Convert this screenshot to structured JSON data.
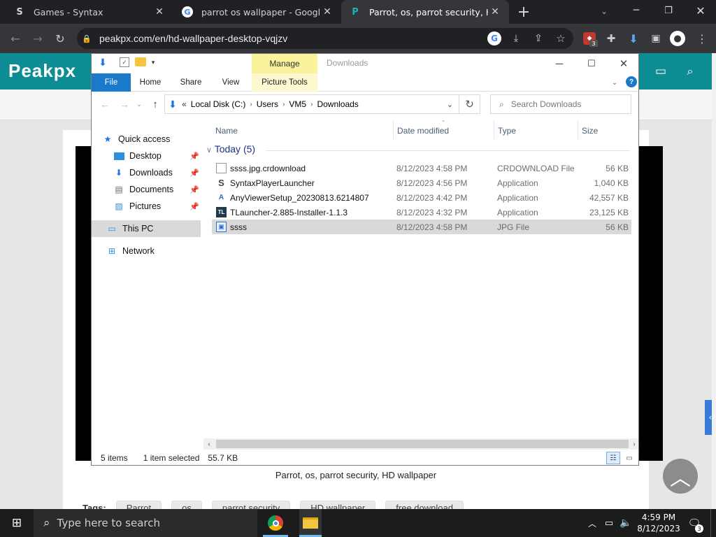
{
  "browser": {
    "tabs": [
      {
        "title": "Games - Syntax",
        "favicon": "S"
      },
      {
        "title": "parrot os wallpaper - Google Sea",
        "favicon": "G"
      },
      {
        "title": "Parrot, os, parrot security, HD wa",
        "favicon": "P"
      }
    ],
    "new_tab": "+",
    "url": "peakpx.com/en/hd-wallpaper-desktop-vqjzv",
    "ext_badge": "3"
  },
  "page": {
    "logo": "Peakpx",
    "caption": "Parrot, os, parrot security, HD wallpaper",
    "tags_label": "Tags:",
    "tags": [
      "Parrot",
      "os",
      "parrot security",
      "HD wallpaper",
      "free download"
    ]
  },
  "explorer": {
    "contextual_tab": "Manage",
    "window_title": "Downloads",
    "ribbon_tabs": [
      "File",
      "Home",
      "Share",
      "View",
      "Picture Tools"
    ],
    "address": {
      "prefix": "«",
      "crumbs": [
        "Local Disk (C:)",
        "Users",
        "VM5",
        "Downloads"
      ]
    },
    "search_placeholder": "Search Downloads",
    "nav_items": [
      {
        "label": "Quick access"
      },
      {
        "label": "Desktop"
      },
      {
        "label": "Downloads"
      },
      {
        "label": "Documents"
      },
      {
        "label": "Pictures"
      },
      {
        "label": "This PC"
      },
      {
        "label": "Network"
      }
    ],
    "columns": [
      "Name",
      "Date modified",
      "Type",
      "Size"
    ],
    "group": "Today (5)",
    "files": [
      {
        "name": "ssss.jpg.crdownload",
        "date": "8/12/2023 4:58 PM",
        "type": "CRDOWNLOAD File",
        "size": "56 KB"
      },
      {
        "name": "SyntaxPlayerLauncher",
        "date": "8/12/2023 4:56 PM",
        "type": "Application",
        "size": "1,040 KB"
      },
      {
        "name": "AnyViewerSetup_20230813.6214807",
        "date": "8/12/2023 4:42 PM",
        "type": "Application",
        "size": "42,557 KB"
      },
      {
        "name": "TLauncher-2.885-Installer-1.1.3",
        "date": "8/12/2023 4:32 PM",
        "type": "Application",
        "size": "23,125 KB"
      },
      {
        "name": "ssss",
        "date": "8/12/2023 4:58 PM",
        "type": "JPG File",
        "size": "56 KB"
      }
    ],
    "status": {
      "items": "5 items",
      "selected": "1 item selected",
      "size": "55.7 KB"
    }
  },
  "taskbar": {
    "search_placeholder": "Type here to search",
    "time": "4:59 PM",
    "date": "8/12/2023",
    "notifications": "3"
  }
}
